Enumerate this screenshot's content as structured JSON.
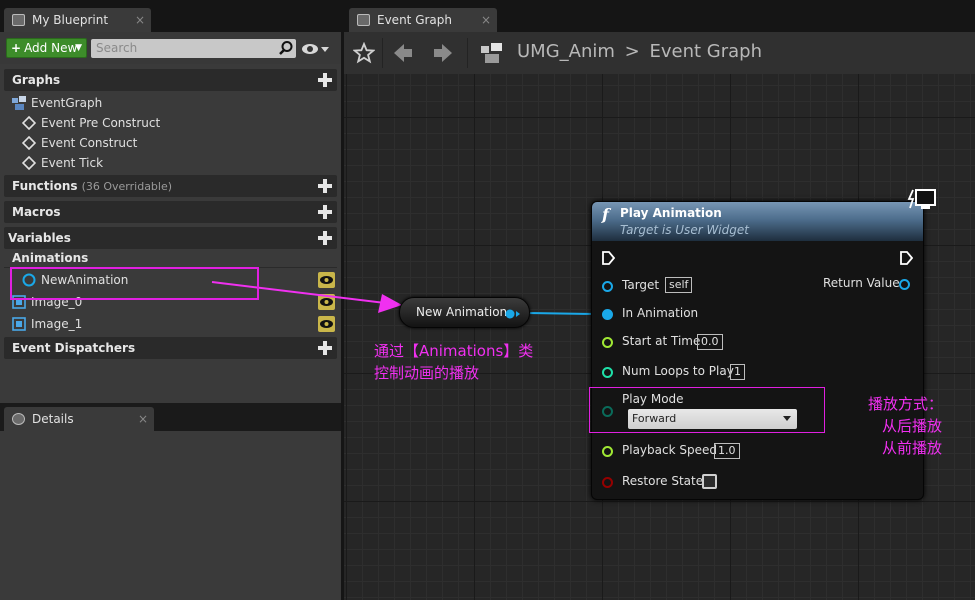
{
  "left_tab": {
    "title": "My Blueprint",
    "close": "×"
  },
  "toolbar": {
    "add_new_label": "Add New",
    "search_placeholder": "Search"
  },
  "sections": {
    "graphs": "Graphs",
    "functions": "Functions",
    "functions_sub": "(36 Overridable)",
    "macros": "Macros",
    "variables": "Variables",
    "animations": "Animations",
    "event_dispatchers": "Event Dispatchers"
  },
  "graph_items": [
    "EventGraph",
    "Event Pre Construct",
    "Event Construct",
    "Event Tick"
  ],
  "animation_items": [
    "NewAnimation",
    "Image_0",
    "Image_1"
  ],
  "details_tab": {
    "title": "Details",
    "close": "×"
  },
  "graph_tab": {
    "title": "Event Graph",
    "close": "×"
  },
  "breadcrumb": {
    "blueprint": "UMG_Anim",
    "separator": ">",
    "graph": "Event Graph"
  },
  "play_node": {
    "title": "Play Animation",
    "subtitle": "Target is User Widget",
    "target_label": "Target",
    "target_value": "self",
    "return_label": "Return Value",
    "in_animation_label": "In Animation",
    "start_time_label": "Start at Time",
    "start_time_value": "0.0",
    "num_loops_label": "Num Loops to Play",
    "num_loops_value": "1",
    "play_mode_label": "Play Mode",
    "play_mode_value": "Forward",
    "playback_speed_label": "Playback Speed",
    "playback_speed_value": "1.0",
    "restore_state_label": "Restore State"
  },
  "var_node": {
    "label": "New Animation"
  },
  "annotations": {
    "note1_line1": "通过【Animations】类",
    "note1_line2": "控制动画的播放",
    "note2_line1": "播放方式：",
    "note2_line2": "从后播放",
    "note2_line3": "从前播放"
  },
  "colors": {
    "annotation": "#f030f0",
    "add_new": "#3d8c2a",
    "header_blue": "#4d6d8c",
    "pin_object": "#1aa8e8",
    "pin_float": "#a0e834",
    "pin_int": "#1fe0a8",
    "pin_enum": "#0a6b5a",
    "pin_bool": "#950000"
  }
}
